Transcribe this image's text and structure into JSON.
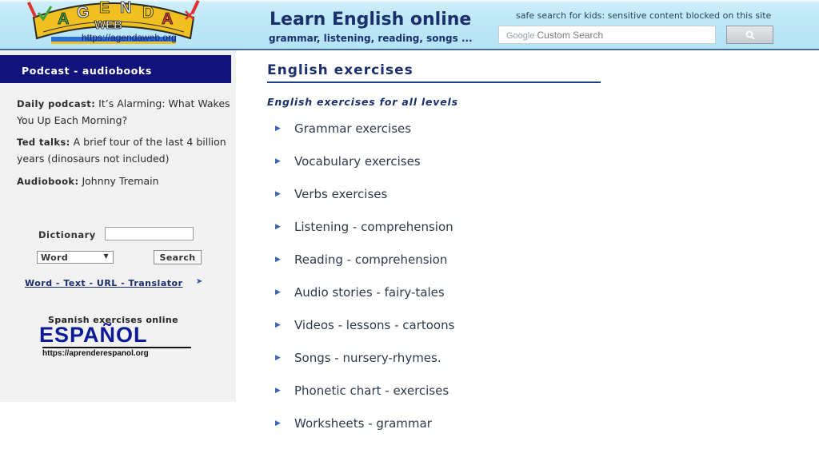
{
  "header": {
    "logo_text": "AGENDA WEB",
    "logo_url": "https://agendaweb.org",
    "title": "Learn English online",
    "subtitle": "grammar, listening, reading, songs ...",
    "safe_search": "safe search for kids: sensitive content blocked on this site",
    "search_google": "Google",
    "search_placeholder": "Custom Search",
    "search_icon": "magnifier-icon"
  },
  "sidebar": {
    "heading": "Podcast - audiobooks",
    "items": [
      {
        "key": "Daily podcast",
        "text": "It’s Alarming: What Wakes You Up Each Morning?"
      },
      {
        "key": "Ted talks",
        "text": "A brief tour of the last 4 billion years (dinosaurs not included)"
      },
      {
        "key": "Audiobook",
        "text": "Johnny Tremain"
      }
    ],
    "dictionary": {
      "label": "Dictionary",
      "select_value": "Word",
      "button": "Search",
      "links": "Word - Text - URL - Translator"
    },
    "espanol": {
      "caption": "Spanish exercises online",
      "logo_text": "ESPAÑOL",
      "url": "https://aprenderespanol.org"
    }
  },
  "main": {
    "title": "English exercises",
    "subtitle": "English exercises for all levels",
    "exercises": [
      "Grammar exercises",
      "Vocabulary exercises",
      "Verbs exercises",
      "Listening - comprehension",
      "Reading - comprehension",
      "Audio stories - fairy-tales",
      "Videos - lessons - cartoons",
      "Songs - nursery-rhymes.",
      "Phonetic chart - exercises",
      "Worksheets - grammar"
    ]
  },
  "colors": {
    "header_bg": "#b3e3f5",
    "navy": "#12137a",
    "title_blue": "#1a2f6b",
    "sidebar_bg": "#f1f1f1"
  }
}
